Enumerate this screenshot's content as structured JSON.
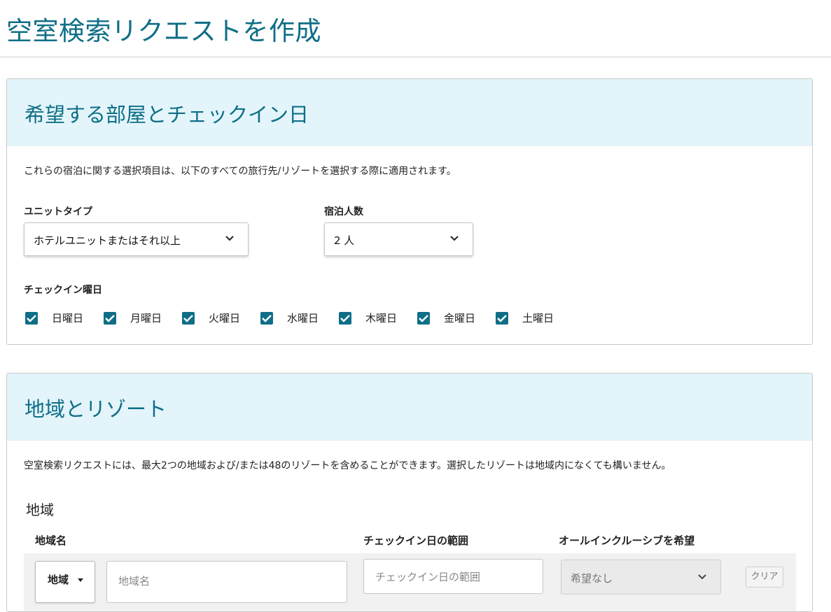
{
  "page": {
    "title": "空室検索リクエストを作成"
  },
  "section1": {
    "heading": "希望する部屋とチェックイン日",
    "description": "これらの宿泊に関する選択項目は、以下のすべての旅行先/リゾートを選択する際に適用されます。",
    "unit_type": {
      "label": "ユニットタイプ",
      "value": "ホテルユニットまたはそれ以上"
    },
    "guests": {
      "label": "宿泊人数",
      "value": "2 人"
    },
    "checkin_days": {
      "label": "チェックイン曜日",
      "days": [
        {
          "label": "日曜日",
          "checked": true
        },
        {
          "label": "月曜日",
          "checked": true
        },
        {
          "label": "火曜日",
          "checked": true
        },
        {
          "label": "水曜日",
          "checked": true
        },
        {
          "label": "木曜日",
          "checked": true
        },
        {
          "label": "金曜日",
          "checked": true
        },
        {
          "label": "土曜日",
          "checked": true
        }
      ]
    }
  },
  "section2": {
    "heading": "地域とリゾート",
    "description": "空室検索リクエストには、最大2つの地域および/または48のリゾートを含めることができます。選択したリゾートは地域内になくても構いません。",
    "sub_heading": "地域",
    "columns": {
      "region_name": "地域名",
      "checkin_range": "チェックイン日の範囲",
      "all_inclusive": "オールインクルーシブを希望"
    },
    "row": {
      "region_type": "地域",
      "region_name_placeholder": "地域名",
      "checkin_range_placeholder": "チェックイン日の範囲",
      "all_inclusive_value": "希望なし",
      "clear_label": "クリア"
    }
  },
  "colors": {
    "accent": "#0f6e87",
    "header_bg": "#e3f5fb"
  }
}
